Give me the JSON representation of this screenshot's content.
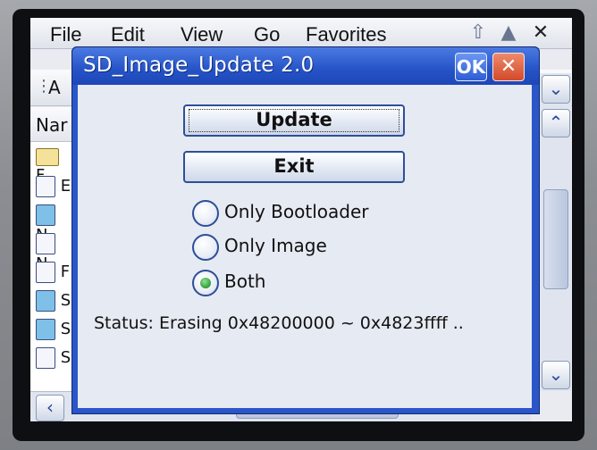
{
  "background_window": {
    "menu": [
      "File",
      "Edit",
      "View",
      "Go",
      "Favorites"
    ],
    "toolbar_address_fragment": "A",
    "list_header_fragment": "Nar",
    "list_row_fragments": [
      "F",
      "E",
      "N",
      "N",
      "F",
      "S",
      "S",
      "S"
    ],
    "close_label": "✕"
  },
  "dialog": {
    "title": "SD_Image_Update 2.0",
    "ok_label": "OK",
    "close_label": "✕",
    "buttons": {
      "update": "Update",
      "exit": "Exit"
    },
    "options": [
      {
        "label": "Only Bootloader",
        "selected": false
      },
      {
        "label": "Only Image",
        "selected": false
      },
      {
        "label": "Both",
        "selected": true
      }
    ],
    "status": "Status: Erasing 0x48200000 ~ 0x4823ffff .."
  },
  "colors": {
    "titlebar": "#2553c7",
    "dialog_body": "#e6eaf2",
    "radio_selected": "#2e9e3a"
  }
}
